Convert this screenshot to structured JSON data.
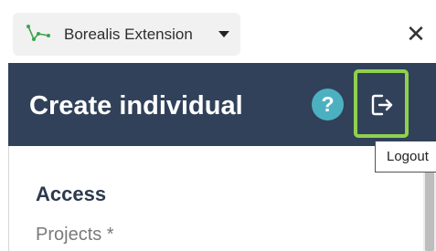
{
  "topbar": {
    "extension_name": "Borealis Extension",
    "logo_icon": "constellation-icon",
    "dropdown_icon": "caret-down-icon",
    "close_label": "✕"
  },
  "header": {
    "title": "Create individual",
    "help_label": "?",
    "logout_icon": "logout-icon"
  },
  "tooltip": {
    "text": "Logout"
  },
  "content": {
    "section_title": "Access",
    "projects_label": "Projects *"
  },
  "colors": {
    "header_bg": "#31415a",
    "help_bg": "#4bb1c0",
    "highlight": "#8fd14f",
    "logo_green": "#3aa64a"
  }
}
